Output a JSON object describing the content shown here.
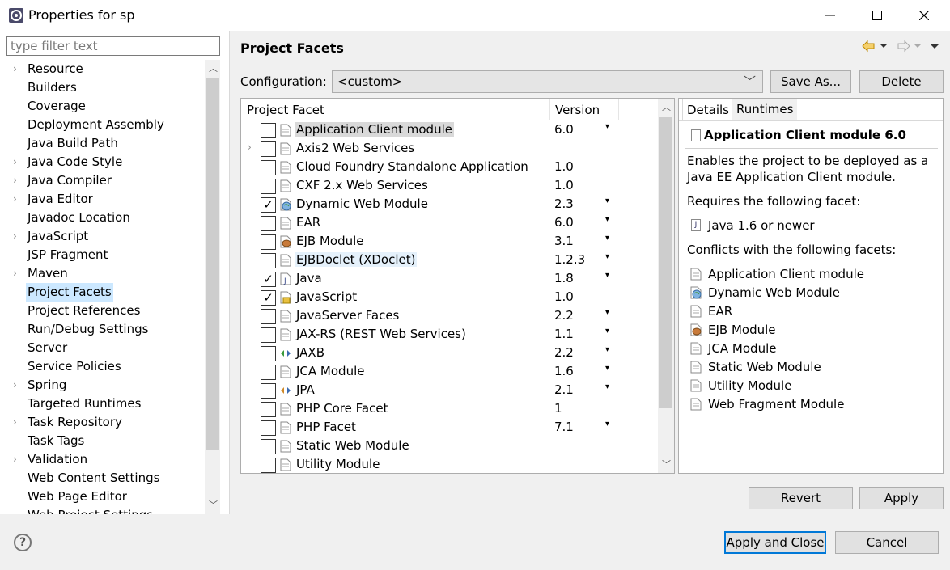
{
  "window": {
    "title": "Properties for sp"
  },
  "filter": {
    "placeholder": "type filter text"
  },
  "tree": {
    "items": [
      {
        "label": "Resource",
        "expandable": true
      },
      {
        "label": "Builders",
        "expandable": false
      },
      {
        "label": "Coverage",
        "expandable": false
      },
      {
        "label": "Deployment Assembly",
        "expandable": false
      },
      {
        "label": "Java Build Path",
        "expandable": false
      },
      {
        "label": "Java Code Style",
        "expandable": true
      },
      {
        "label": "Java Compiler",
        "expandable": true
      },
      {
        "label": "Java Editor",
        "expandable": true
      },
      {
        "label": "Javadoc Location",
        "expandable": false
      },
      {
        "label": "JavaScript",
        "expandable": true
      },
      {
        "label": "JSP Fragment",
        "expandable": false
      },
      {
        "label": "Maven",
        "expandable": true
      },
      {
        "label": "Project Facets",
        "expandable": false,
        "selected": true
      },
      {
        "label": "Project References",
        "expandable": false
      },
      {
        "label": "Run/Debug Settings",
        "expandable": false
      },
      {
        "label": "Server",
        "expandable": false
      },
      {
        "label": "Service Policies",
        "expandable": false
      },
      {
        "label": "Spring",
        "expandable": true
      },
      {
        "label": "Targeted Runtimes",
        "expandable": false
      },
      {
        "label": "Task Repository",
        "expandable": true
      },
      {
        "label": "Task Tags",
        "expandable": false
      },
      {
        "label": "Validation",
        "expandable": true
      },
      {
        "label": "Web Content Settings",
        "expandable": false
      },
      {
        "label": "Web Page Editor",
        "expandable": false
      },
      {
        "label": "Web Project Settings",
        "expandable": false
      }
    ]
  },
  "page": {
    "title": "Project Facets",
    "config_label": "Configuration:",
    "config_value": "<custom>",
    "save_as_label": "Save As...",
    "delete_label": "Delete"
  },
  "facets": {
    "col_facet": "Project Facet",
    "col_version": "Version",
    "rows": [
      {
        "name": "Application Client module",
        "version": "6.0",
        "checked": false,
        "dropdown": true,
        "icon": "doc-icon",
        "highlight": "gray"
      },
      {
        "name": "Axis2 Web Services",
        "version": "",
        "checked": false,
        "dropdown": false,
        "icon": "doc-icon",
        "expandable": true
      },
      {
        "name": "Cloud Foundry Standalone Application",
        "version": "1.0",
        "checked": false,
        "dropdown": false,
        "icon": "doc-icon"
      },
      {
        "name": "CXF 2.x Web Services",
        "version": "1.0",
        "checked": false,
        "dropdown": false,
        "icon": "doc-icon"
      },
      {
        "name": "Dynamic Web Module",
        "version": "2.3",
        "checked": true,
        "dropdown": true,
        "icon": "globe-icon"
      },
      {
        "name": "EAR",
        "version": "6.0",
        "checked": false,
        "dropdown": true,
        "icon": "doc-icon"
      },
      {
        "name": "EJB Module",
        "version": "3.1",
        "checked": false,
        "dropdown": true,
        "icon": "bean-icon"
      },
      {
        "name": "EJBDoclet (XDoclet)",
        "version": "1.2.3",
        "checked": false,
        "dropdown": true,
        "icon": "doc-icon",
        "highlight": "blue"
      },
      {
        "name": "Java",
        "version": "1.8",
        "checked": true,
        "dropdown": true,
        "icon": "java-icon"
      },
      {
        "name": "JavaScript",
        "version": "1.0",
        "checked": true,
        "dropdown": false,
        "icon": "js-icon"
      },
      {
        "name": "JavaServer Faces",
        "version": "2.2",
        "checked": false,
        "dropdown": true,
        "icon": "doc-icon"
      },
      {
        "name": "JAX-RS (REST Web Services)",
        "version": "1.1",
        "checked": false,
        "dropdown": true,
        "icon": "doc-icon"
      },
      {
        "name": "JAXB",
        "version": "2.2",
        "checked": false,
        "dropdown": true,
        "icon": "jaxb-icon"
      },
      {
        "name": "JCA Module",
        "version": "1.6",
        "checked": false,
        "dropdown": true,
        "icon": "doc-icon"
      },
      {
        "name": "JPA",
        "version": "2.1",
        "checked": false,
        "dropdown": true,
        "icon": "jpa-icon"
      },
      {
        "name": "PHP Core Facet",
        "version": "1",
        "checked": false,
        "dropdown": false,
        "icon": "doc-icon"
      },
      {
        "name": "PHP Facet",
        "version": "7.1",
        "checked": false,
        "dropdown": true,
        "icon": "doc-icon"
      },
      {
        "name": "Static Web Module",
        "version": "",
        "checked": false,
        "dropdown": false,
        "icon": "doc-icon"
      },
      {
        "name": "Utility Module",
        "version": "",
        "checked": false,
        "dropdown": false,
        "icon": "doc-icon"
      }
    ]
  },
  "details": {
    "tab_details": "Details",
    "tab_runtimes": "Runtimes",
    "heading": "Application Client module 6.0",
    "desc_line1": "Enables the project to be deployed as a",
    "desc_line2": "Java EE Application Client module.",
    "requires_label": "Requires the following facet:",
    "requires_item": "Java 1.6 or newer",
    "conflicts_label": "Conflicts with the following facets:",
    "conflicts": [
      {
        "name": "Application Client module",
        "icon": "doc-icon"
      },
      {
        "name": "Dynamic Web Module",
        "icon": "globe-icon"
      },
      {
        "name": "EAR",
        "icon": "doc-icon"
      },
      {
        "name": "EJB Module",
        "icon": "bean-icon"
      },
      {
        "name": "JCA Module",
        "icon": "doc-icon"
      },
      {
        "name": "Static Web Module",
        "icon": "doc-icon"
      },
      {
        "name": "Utility Module",
        "icon": "doc-icon"
      },
      {
        "name": "Web Fragment Module",
        "icon": "doc-icon"
      }
    ]
  },
  "buttons": {
    "revert": "Revert",
    "apply": "Apply",
    "apply_close": "Apply and Close",
    "cancel": "Cancel"
  },
  "colors": {
    "selection": "#cce8ff",
    "dialog_bg": "#f0f0f0",
    "default_button_border": "#0078d7",
    "nav_arrow": "#e0a800"
  }
}
